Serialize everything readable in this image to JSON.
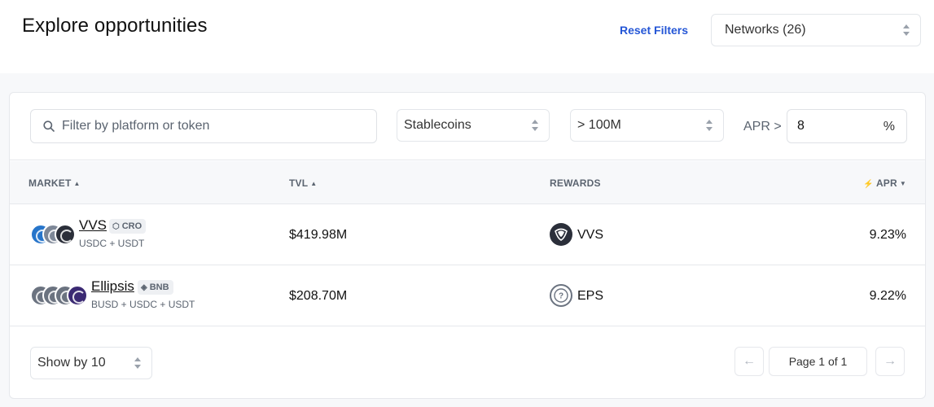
{
  "header": {
    "title": "Explore opportunities",
    "reset_filters": "Reset Filters",
    "networks_select": "Networks (26)"
  },
  "filters": {
    "search_placeholder": "Filter by platform or token",
    "category_select": "Stablecoins",
    "tvl_select": "> 100M",
    "apr_label": "APR >",
    "apr_value": "8",
    "apr_unit": "%"
  },
  "table": {
    "columns": {
      "market": "MARKET",
      "tvl": "TVL",
      "rewards": "REWARDS",
      "apr": "APR"
    },
    "rows": [
      {
        "market": "VVS",
        "chain": "CRO",
        "pair": "USDC + USDT",
        "tvl": "$419.98M",
        "reward": "VVS",
        "apr": "9.23%"
      },
      {
        "market": "Ellipsis",
        "chain": "BNB",
        "pair": "BUSD + USDC + USDT",
        "tvl": "$208.70M",
        "reward": "EPS",
        "apr": "9.22%"
      }
    ]
  },
  "pagination": {
    "show_by": "Show by 10",
    "page_label": "Page 1 of 1",
    "prev": "←",
    "next": "→"
  },
  "colors": {
    "accent": "#2456d6",
    "usdc": "#2775ca",
    "usdt": "#7d8797",
    "busd": "#6b7380",
    "vvs": "#2b2f3a",
    "ellipsis": "#3b2a73"
  }
}
